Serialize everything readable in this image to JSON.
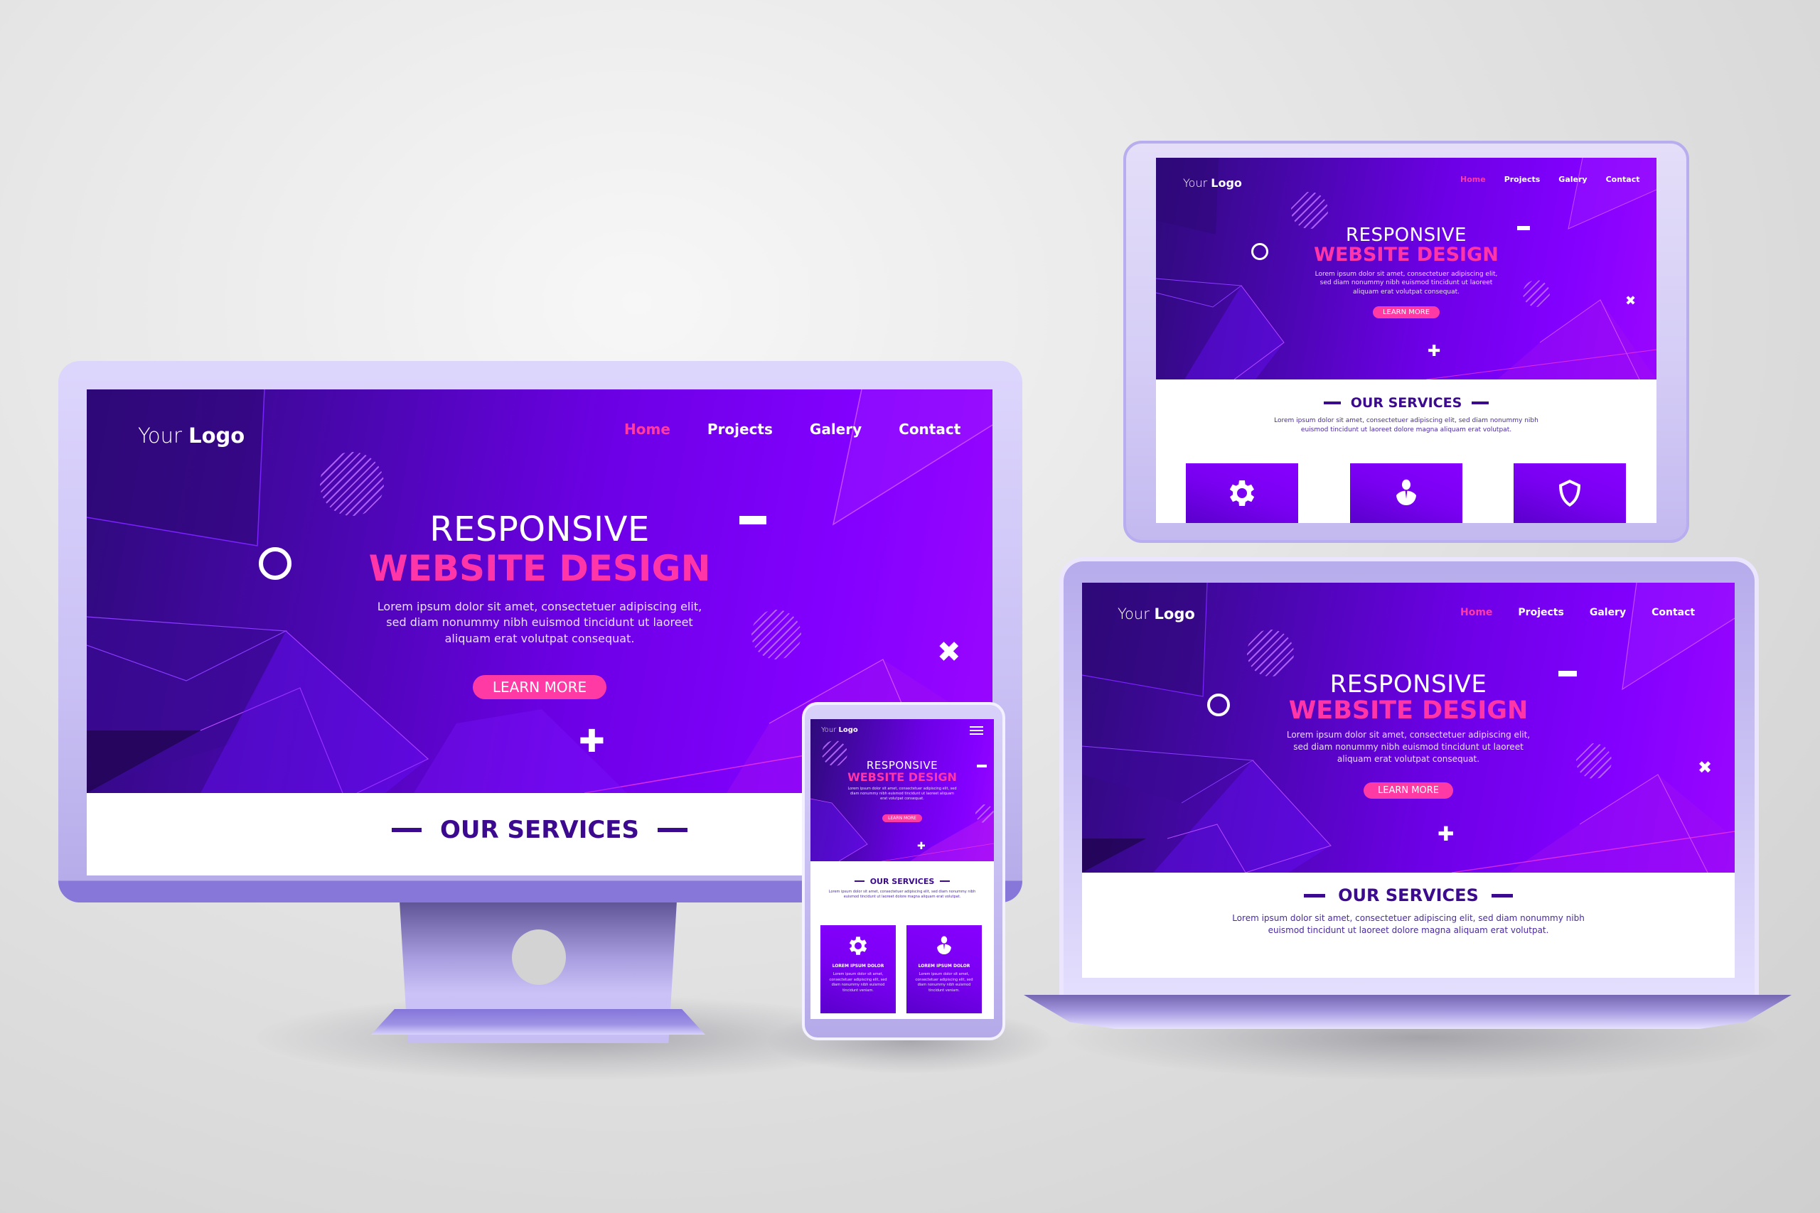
{
  "site": {
    "logo_regular": "Your ",
    "logo_bold": "Logo",
    "nav": [
      "Home",
      "Projects",
      "Galery",
      "Contact"
    ],
    "active_nav": "Home",
    "hero_title_line1": "RESPONSIVE",
    "hero_title_line2": "WEBSITE DESIGN",
    "hero_text": "Lorem ipsum dolor sit amet, consectetuer adipiscing elit, sed diam nonummy nibh euismod tincidunt ut laoreet aliquam erat volutpat consequat.",
    "hero_text_lines": [
      "Lorem ipsum dolor sit amet, consectetuer adipiscing elit,",
      "sed diam nonummy nibh euismod tincidunt ut laoreet",
      "aliquam erat volutpat consequat."
    ],
    "mobile_hero_text_lines": [
      "Lorem ipsum dolor sit amet, consectetuer adipiscing elit, sed",
      "diam nonummy nibh euismod tincidunt ut laoreet aliquam",
      "erat volutpat consequat."
    ],
    "cta_label": "LEARN MORE",
    "services_title": "OUR SERVICES",
    "services_text_lines": [
      "Lorem ipsum dolor sit amet, consectetuer adipiscing elit, sed diam nonummy nibh",
      "euismod tincidunt ut laoreet dolore magna aliquam erat volutpat."
    ],
    "service_cards": [
      {
        "icon": "gear-icon",
        "title": "LOREM IPSUM DOLOR",
        "text_lines": [
          "Lorem ipsum dolor sit amet,",
          "consectetuer adipiscing elit, sed",
          "diam nonummy nibh euismod",
          "tincidunt  veniam."
        ]
      },
      {
        "icon": "user-icon",
        "title": "LOREM IPSUM DOLOR",
        "text_lines": [
          "Lorem ipsum dolor sit amet,",
          "consectetuer adipiscing elit, sed",
          "diam nonummy nibh euismod",
          "tincidunt  veniam."
        ]
      },
      {
        "icon": "shield-icon",
        "title": "",
        "text_lines": []
      }
    ],
    "menu_icon": "hamburger-menu-icon"
  },
  "devices": [
    "desktop-monitor",
    "tablet",
    "laptop",
    "mobile-phone"
  ],
  "colors": {
    "accent_pink": "#ff3aa4",
    "hero_purple": "#6d00e6",
    "navy_text": "#3b0a8f",
    "bezel_lavender": "#c6bdf2"
  }
}
